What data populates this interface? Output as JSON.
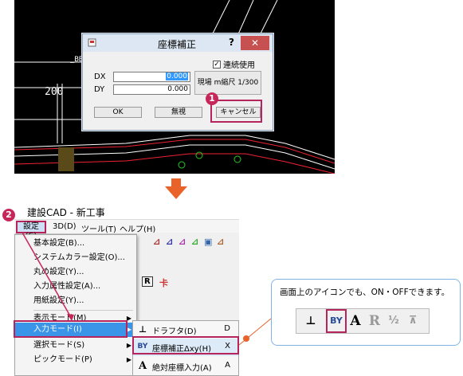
{
  "dialog": {
    "title": "座標補正",
    "help": "?",
    "close": "✕",
    "continuous_label": "連続使用",
    "continuous_mark": "✓",
    "dx_label": "DX",
    "dy_label": "DY",
    "dx_value": "0.000",
    "dy_value": "0.000",
    "scale_button": "現場 m縮尺 1/300",
    "ok_button": "OK",
    "ignore_button": "無視",
    "cancel_button": "キャンセル"
  },
  "cad": {
    "label_200": "200",
    "label_small": "_BB"
  },
  "markers": {
    "step1": "1",
    "step2": "2"
  },
  "app": {
    "title": "建設CAD - 新工事",
    "menus": {
      "settings": "設定(S)",
      "threed": "3D(D)",
      "tools": "ツール(T)",
      "help": "ヘルプ(H)"
    }
  },
  "dropdown": {
    "items": [
      "基本設定(B)...",
      "システムカラー設定(O)...",
      "丸め設定(Y)...",
      "入力属性設定(A)...",
      "用紙設定(Y)...",
      "表示モード(M)",
      "入力モード(I)",
      "選択モード(S)",
      "ピックモード(P)"
    ],
    "arrow": "▶"
  },
  "submenu": {
    "items": [
      {
        "icon": "⊥",
        "label": "ドラフタ(D)",
        "key": "D"
      },
      {
        "icon": "BY",
        "label": "座標補正Δxy(H)",
        "key": "X"
      },
      {
        "icon": "A",
        "label": "絶対座標入力(A)",
        "key": "A"
      }
    ]
  },
  "callout": {
    "text": "画面上のアイコンでも、ON・OFFできます。",
    "icons": [
      "⊥",
      "BY",
      "A",
      "R",
      "½",
      "⊼"
    ]
  },
  "colors": {
    "accent": "#b5245a",
    "arrow": "#e8622a",
    "menu_highlight": "#3a95e8"
  }
}
